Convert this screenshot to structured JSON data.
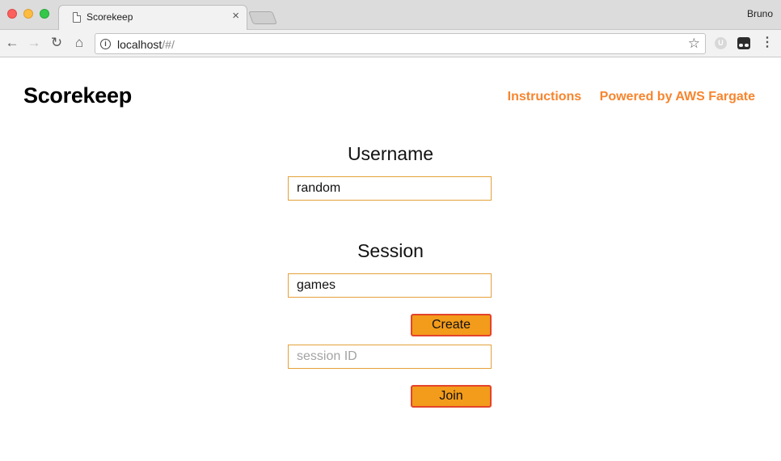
{
  "browser": {
    "tab_title": "Scorekeep",
    "tab_close": "×",
    "profile_name": "Bruno",
    "url_host": "localhost",
    "url_path": "/#/"
  },
  "header": {
    "brand": "Scorekeep",
    "links": [
      "Instructions",
      "Powered by AWS Fargate"
    ],
    "link_color": "#f7852e"
  },
  "form": {
    "username_label": "Username",
    "username_value": "random",
    "session_label": "Session",
    "session_value": "games",
    "create_label": "Create",
    "session_id_placeholder": "session ID",
    "join_label": "Join",
    "accent_color": "#f39b1a",
    "field_border_color": "#e4a13a"
  },
  "icons": [
    "close-icon",
    "back-arrow-icon",
    "forward-arrow-icon",
    "reload-icon",
    "home-icon",
    "info-icon",
    "star-icon",
    "extension-icon",
    "incognito-icon",
    "menu-icon",
    "document-icon"
  ]
}
